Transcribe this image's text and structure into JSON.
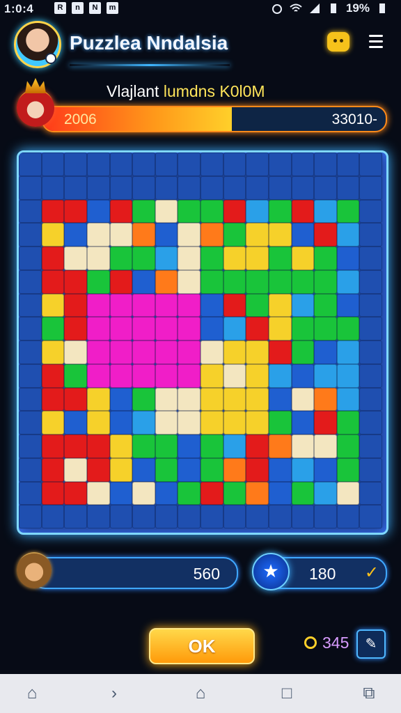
{
  "status_bar": {
    "time": "1:0:4",
    "notifications": [
      "R",
      "n",
      "N",
      "m"
    ],
    "battery": "19%"
  },
  "header": {
    "title": "Puzzlea Nndalsia",
    "icons": [
      "avatar",
      "chat-icon",
      "menu-icon"
    ]
  },
  "level": {
    "label_prefix": "Vlajlant ",
    "label_highlight": "lumdns",
    "label_suffix": " K0l0M",
    "progress_left": "2006",
    "progress_right": "33010-",
    "progress_fraction": 0.55
  },
  "board": {
    "columns": 16,
    "rows": 16
  },
  "stats": {
    "left_value": "560",
    "right_value": "180",
    "right_icon": "star-icon",
    "right_badge": "check-icon"
  },
  "actions": {
    "ok_label": "OK",
    "coins": "345",
    "edit_icon": "edit-icon"
  },
  "nav": {
    "items": [
      "home-icon",
      "forward-icon",
      "house-icon",
      "square-icon",
      "tabs-icon"
    ]
  },
  "colors": {
    "accent": "#3fb6ff",
    "progress": "#ff8a1a",
    "ok": "#ffb01a"
  }
}
